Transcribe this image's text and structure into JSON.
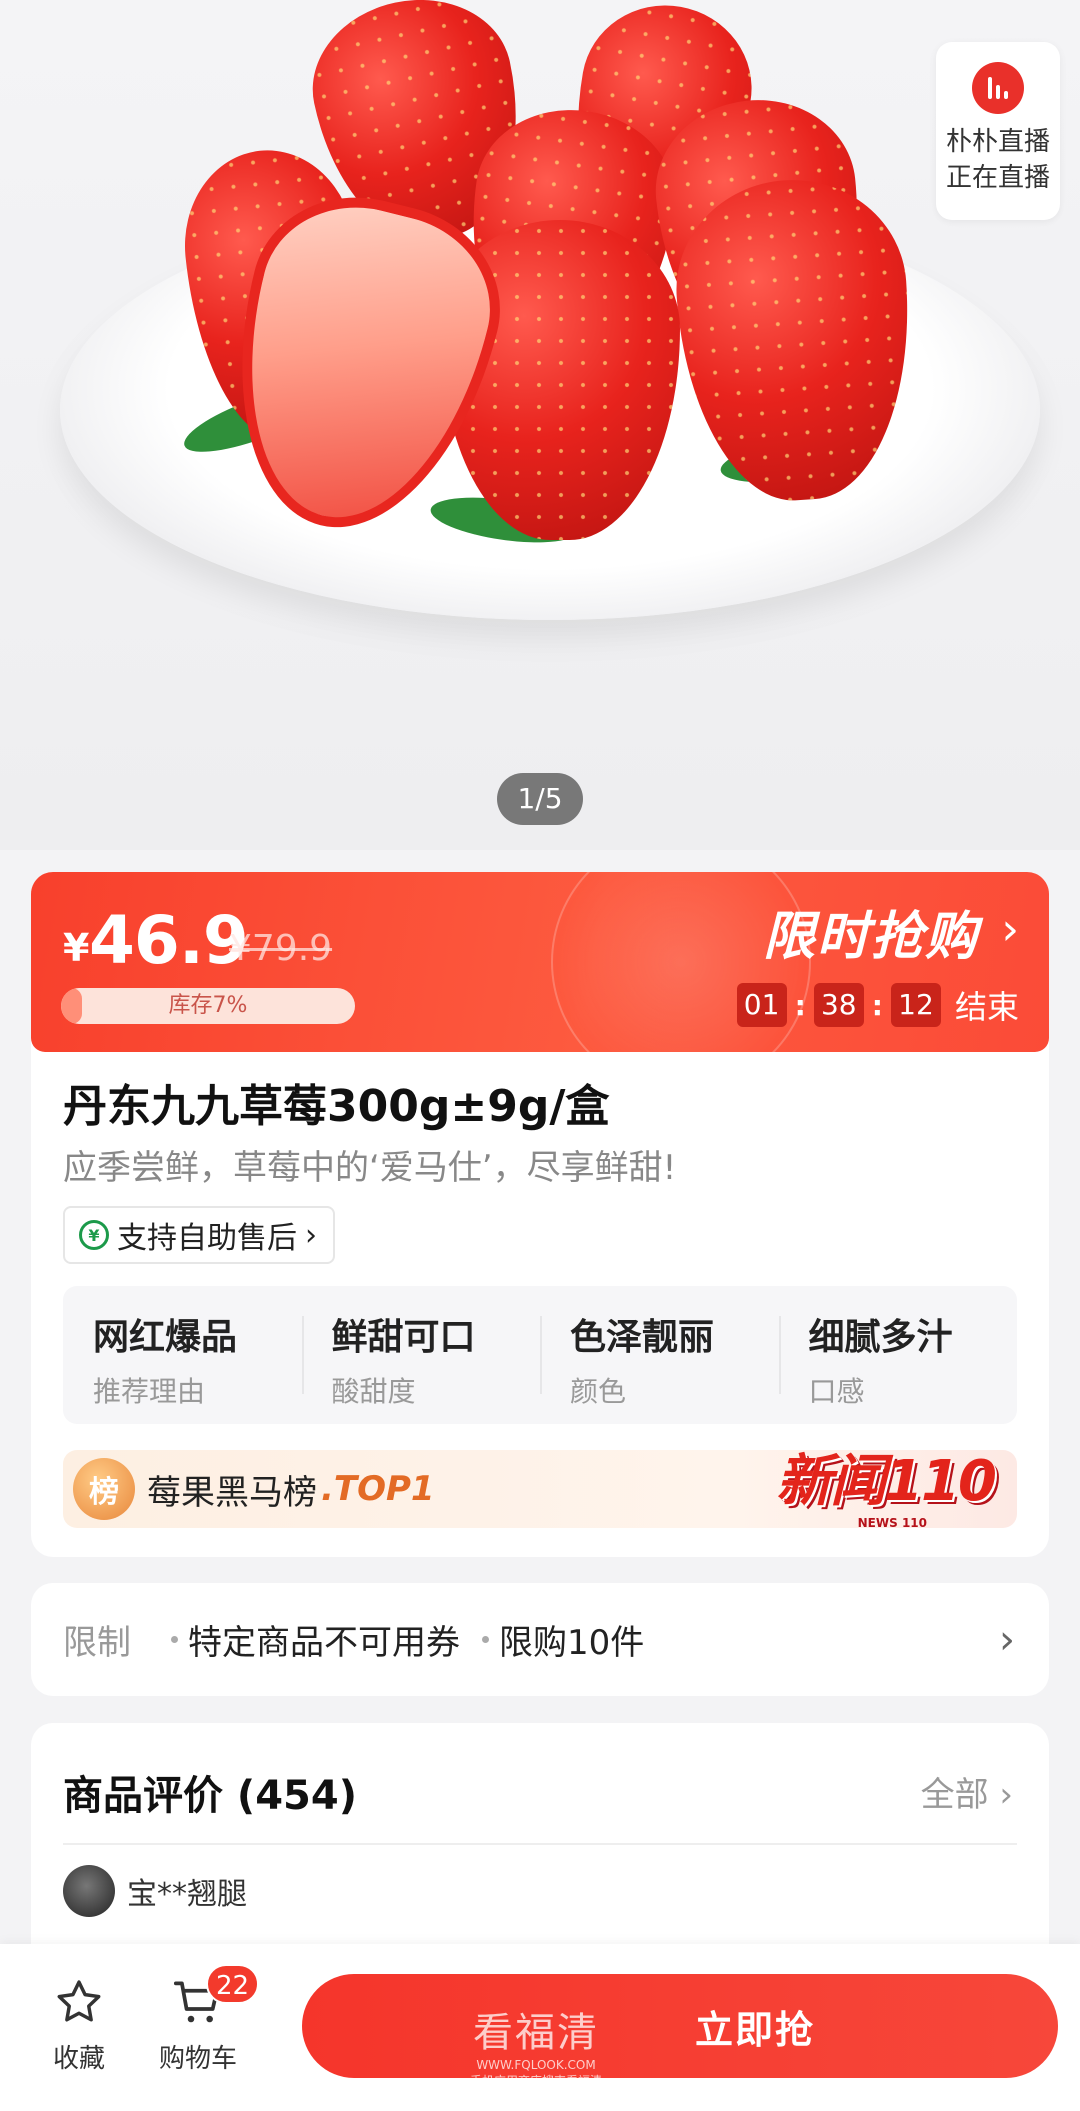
{
  "hero": {
    "live_badge": {
      "line1": "朴朴直播",
      "line2": "正在直播"
    },
    "pager": "1/5"
  },
  "flash_sale": {
    "currency": "¥",
    "price": "46.9",
    "original_price": "¥79.9",
    "stock_label": "库存7%",
    "stock_percent": 7,
    "title": "限时抢购",
    "arrow": "›",
    "timer": {
      "h": "01",
      "m": "38",
      "s": "12",
      "sep": ":",
      "suffix": "结束"
    }
  },
  "product": {
    "title": "丹东九九草莓300g±9g/盒",
    "subtitle": "应季尝鲜，草莓中的‘爱马仕’，尽享鲜甜!",
    "after_sale": "支持自助售后",
    "after_sale_arrow": "›",
    "features": [
      {
        "value": "网红爆品",
        "key": "推荐理由"
      },
      {
        "value": "鲜甜可口",
        "key": "酸甜度"
      },
      {
        "value": "色泽靓丽",
        "key": "颜色"
      },
      {
        "value": "细腻多汁",
        "key": "口感"
      }
    ],
    "rank": {
      "icon": "榜",
      "text": "莓果黑马榜",
      "top": ".TOP1",
      "logo": "新闻110",
      "logo_sub": "NEWS 110"
    }
  },
  "limits": {
    "label": "限制",
    "items": [
      "特定商品不可用券",
      "限购10件"
    ],
    "arrow": "›"
  },
  "reviews": {
    "title": "商品评价 (454)",
    "all": "全部 ›",
    "first_user": "宝**翘腿"
  },
  "bottom_bar": {
    "favorite": "收藏",
    "cart": "购物车",
    "cart_count": "22",
    "buy": "立即抢"
  },
  "watermark": {
    "text": "看福清",
    "url": "WWW.FQLOOK.COM",
    "note": "手机应用商店搜索看福清"
  },
  "colors": {
    "accent": "#f5352b",
    "flash_bg": "#fd5a3f",
    "green": "#1c9a4a"
  }
}
